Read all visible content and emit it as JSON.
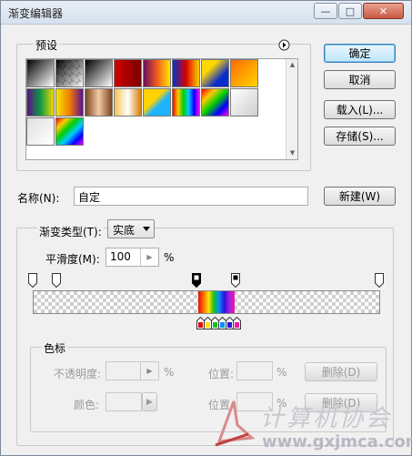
{
  "window": {
    "title": "渐变编辑器",
    "controls": {
      "minimize": "—",
      "maximize": "□",
      "close": "✕"
    }
  },
  "presets": {
    "label": "预设",
    "menu_icon": "arrow-right-circle-icon",
    "swatches": [
      "linear-gradient(135deg,#000,#fff)",
      "linear-gradient(135deg,#000,rgba(0,0,0,0))",
      "linear-gradient(135deg,#000,#fff)",
      "linear-gradient(90deg,#d00000,#7a0000)",
      "linear-gradient(90deg,#6a0f5e,#f05a1e,#ffe500)",
      "linear-gradient(90deg,#0033cc,#d80000,#ffd000)",
      "linear-gradient(135deg,#ffd800 30%,#0b2ccc 70%)",
      "linear-gradient(135deg,#ff6a00,#ffd400)",
      "linear-gradient(90deg,#5b1082,#0a9b44,#f2d800)",
      "linear-gradient(90deg,#f2e600,#f27e00,#5b0f8f)",
      "linear-gradient(90deg,#7a4620,#f1cba6,#7a4620)",
      "linear-gradient(90deg,#f2c24e,#fff,#d47c00)",
      "linear-gradient(135deg,#ffd200 40%,#1cb4ff 60%)",
      "linear-gradient(90deg,#ff0000,#ffcc00,#00d000,#00ccff,#0000ff,#ff00ff)",
      "linear-gradient(135deg,#ff0000,#ffcc00,#00d000,#0000ff,#ff00ff)",
      "linear-gradient(135deg,#fff,#cfcfcf)",
      "linear-gradient(135deg,#e0e0e0,#ffffff)",
      "linear-gradient(135deg,#ff0000,#ffcc00,#00d000,#00ccff,#0000ff,#ff00ff)"
    ]
  },
  "buttons": {
    "ok": "确定",
    "cancel": "取消",
    "load": "载入(L)...",
    "save": "存储(S)...",
    "new": "新建(W)",
    "delete_opacity": "删除(D)",
    "delete_color": "删除(D)"
  },
  "name": {
    "label": "名称(N):",
    "value": "自定"
  },
  "gradient_type": {
    "label": "渐变类型(T):",
    "value": "实底"
  },
  "smoothness": {
    "label": "平滑度(M):",
    "value": "100",
    "unit": "%"
  },
  "stops": {
    "group_label": "色标",
    "opacity_label": "不透明度:",
    "opacity_unit": "%",
    "opacity_location_label": "位置:",
    "opacity_location_unit": "%",
    "color_label": "颜色:",
    "color_location_label": "位置:",
    "color_location_unit": "%"
  },
  "watermark": {
    "text": "计算机协会",
    "url": "www.gxjmca.com"
  },
  "colors": {
    "accent_button": "#bee6fd",
    "panel_bg": "#f0f0f0"
  }
}
